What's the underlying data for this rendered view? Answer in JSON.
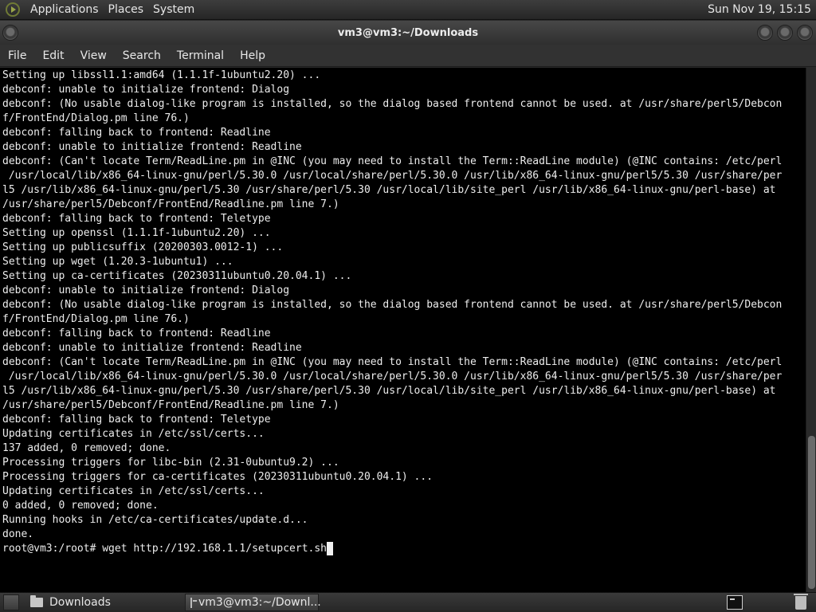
{
  "top_panel": {
    "menus": [
      "Applications",
      "Places",
      "System"
    ],
    "clock": "Sun Nov 19, 15:15"
  },
  "window": {
    "title": "vm3@vm3:~/Downloads"
  },
  "menubar": [
    "File",
    "Edit",
    "View",
    "Search",
    "Terminal",
    "Help"
  ],
  "terminal": {
    "lines": [
      "Setting up libssl1.1:amd64 (1.1.1f-1ubuntu2.20) ...",
      "debconf: unable to initialize frontend: Dialog",
      "debconf: (No usable dialog-like program is installed, so the dialog based frontend cannot be used. at /usr/share/perl5/Debcon",
      "f/FrontEnd/Dialog.pm line 76.)",
      "debconf: falling back to frontend: Readline",
      "debconf: unable to initialize frontend: Readline",
      "debconf: (Can't locate Term/ReadLine.pm in @INC (you may need to install the Term::ReadLine module) (@INC contains: /etc/perl",
      " /usr/local/lib/x86_64-linux-gnu/perl/5.30.0 /usr/local/share/perl/5.30.0 /usr/lib/x86_64-linux-gnu/perl5/5.30 /usr/share/per",
      "l5 /usr/lib/x86_64-linux-gnu/perl/5.30 /usr/share/perl/5.30 /usr/local/lib/site_perl /usr/lib/x86_64-linux-gnu/perl-base) at",
      "/usr/share/perl5/Debconf/FrontEnd/Readline.pm line 7.)",
      "debconf: falling back to frontend: Teletype",
      "Setting up openssl (1.1.1f-1ubuntu2.20) ...",
      "Setting up publicsuffix (20200303.0012-1) ...",
      "Setting up wget (1.20.3-1ubuntu1) ...",
      "Setting up ca-certificates (20230311ubuntu0.20.04.1) ...",
      "debconf: unable to initialize frontend: Dialog",
      "debconf: (No usable dialog-like program is installed, so the dialog based frontend cannot be used. at /usr/share/perl5/Debcon",
      "f/FrontEnd/Dialog.pm line 76.)",
      "debconf: falling back to frontend: Readline",
      "debconf: unable to initialize frontend: Readline",
      "debconf: (Can't locate Term/ReadLine.pm in @INC (you may need to install the Term::ReadLine module) (@INC contains: /etc/perl",
      " /usr/local/lib/x86_64-linux-gnu/perl/5.30.0 /usr/local/share/perl/5.30.0 /usr/lib/x86_64-linux-gnu/perl5/5.30 /usr/share/per",
      "l5 /usr/lib/x86_64-linux-gnu/perl/5.30 /usr/share/perl/5.30 /usr/local/lib/site_perl /usr/lib/x86_64-linux-gnu/perl-base) at",
      "/usr/share/perl5/Debconf/FrontEnd/Readline.pm line 7.)",
      "debconf: falling back to frontend: Teletype",
      "Updating certificates in /etc/ssl/certs...",
      "137 added, 0 removed; done.",
      "Processing triggers for libc-bin (2.31-0ubuntu9.2) ...",
      "Processing triggers for ca-certificates (20230311ubuntu0.20.04.1) ...",
      "Updating certificates in /etc/ssl/certs...",
      "0 added, 0 removed; done.",
      "Running hooks in /etc/ca-certificates/update.d...",
      "done."
    ],
    "prompt": "root@vm3:/root# ",
    "command": "wget http://192.168.1.1/setupcert.sh"
  },
  "taskbar": {
    "items": [
      {
        "label": "Downloads",
        "icon": "folder-icon"
      },
      {
        "label": "vm3@vm3:~/Downl...",
        "icon": "terminal-icon"
      }
    ]
  }
}
